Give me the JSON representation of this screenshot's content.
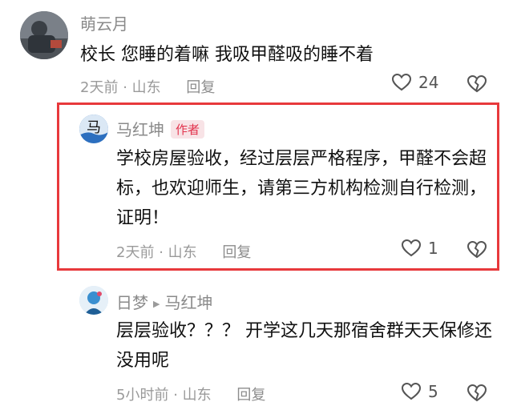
{
  "comments": [
    {
      "user": "萌云月",
      "text": "校长 您睡的着嘛 我吸甲醛吸的睡不着",
      "time": "2天前",
      "location": "山东",
      "reply_label": "回复",
      "likes": "24"
    },
    {
      "user": "马红坤",
      "badge": "作者",
      "text": "学校房屋验收，经过层层严格程序，甲醛不会超标，也欢迎师生，请第三方机构检测自行检测，证明！",
      "time": "2天前",
      "location": "山东",
      "reply_label": "回复",
      "likes": "1"
    },
    {
      "user": "日梦",
      "reply_to": "马红坤",
      "text": "层层验收？？？ 开学这几天那宿舍群天天保修还没用呢",
      "time": "5小时前",
      "location": "山东",
      "reply_label": "回复",
      "likes": "5"
    }
  ],
  "meta_separator": "·",
  "colors": {
    "highlight_border": "#e8393c",
    "badge_bg": "#f8e3e6",
    "badge_text": "#e2334d",
    "meta_gray": "#9a9a9a"
  },
  "icons": [
    "heart-outline-icon",
    "broken-heart-icon",
    "reply-arrow-icon"
  ]
}
